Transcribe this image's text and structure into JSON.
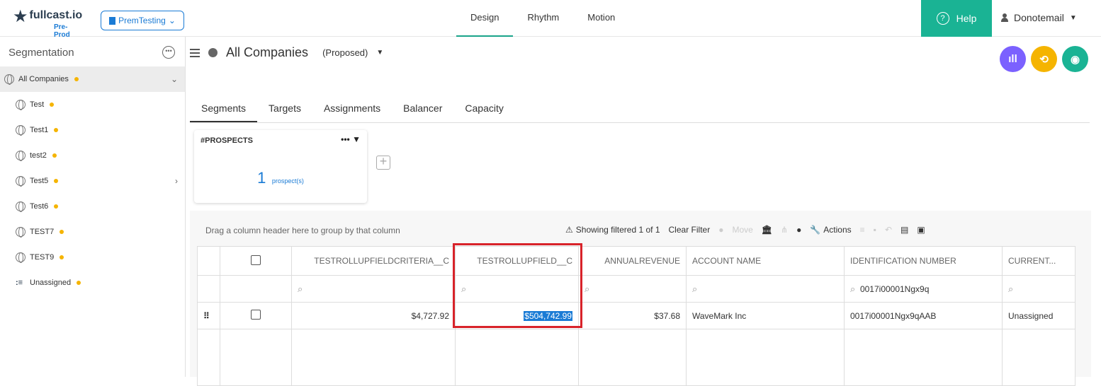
{
  "header": {
    "brand": "fullcast.io",
    "brand_sub": "Pre-Prod",
    "project": "PremTesting",
    "nav": [
      "Design",
      "Rhythm",
      "Motion"
    ],
    "help_label": "Help",
    "user": "Donotemail"
  },
  "sidebar": {
    "title": "Segmentation",
    "items": [
      {
        "label": "All Companies"
      },
      {
        "label": "Test"
      },
      {
        "label": "Test1"
      },
      {
        "label": "test2"
      },
      {
        "label": "Test5"
      },
      {
        "label": "Test6"
      },
      {
        "label": "TEST7"
      },
      {
        "label": "TEST9"
      },
      {
        "label": "Unassigned"
      }
    ]
  },
  "main": {
    "title": "All Companies",
    "status": "(Proposed)",
    "tabs": [
      "Segments",
      "Targets",
      "Assignments",
      "Balancer",
      "Capacity"
    ],
    "card": {
      "title": "#PROSPECTS",
      "count": "1",
      "count_label": "prospect(s)"
    }
  },
  "grid": {
    "drag_hint": "Drag a column header here to group by that column",
    "toolbar": {
      "filter_status": "Showing filtered 1 of 1",
      "clear_filter": "Clear Filter",
      "move": "Move",
      "actions": "Actions"
    },
    "columns": [
      "TESTROLLUPFIELDCRITERIA__C",
      "TESTROLLUPFIELD__C",
      "ANNUALREVENUE",
      "ACCOUNT NAME",
      "IDENTIFICATION NUMBER",
      "CURRENT..."
    ],
    "filters": {
      "identification_number": "0017i00001Ngx9q"
    },
    "rows": [
      {
        "criteria": "$4,727.92",
        "rollup": "$504,742.99",
        "revenue": "$37.68",
        "account": "WaveMark Inc",
        "id_number": "0017i00001Ngx9qAAB",
        "current": "Unassigned"
      }
    ]
  },
  "colors": {
    "accent_green": "#1ab394",
    "brand_blue": "#1a7bd5",
    "highlight_red": "#d8232a",
    "status_dot": "#f5b400"
  }
}
